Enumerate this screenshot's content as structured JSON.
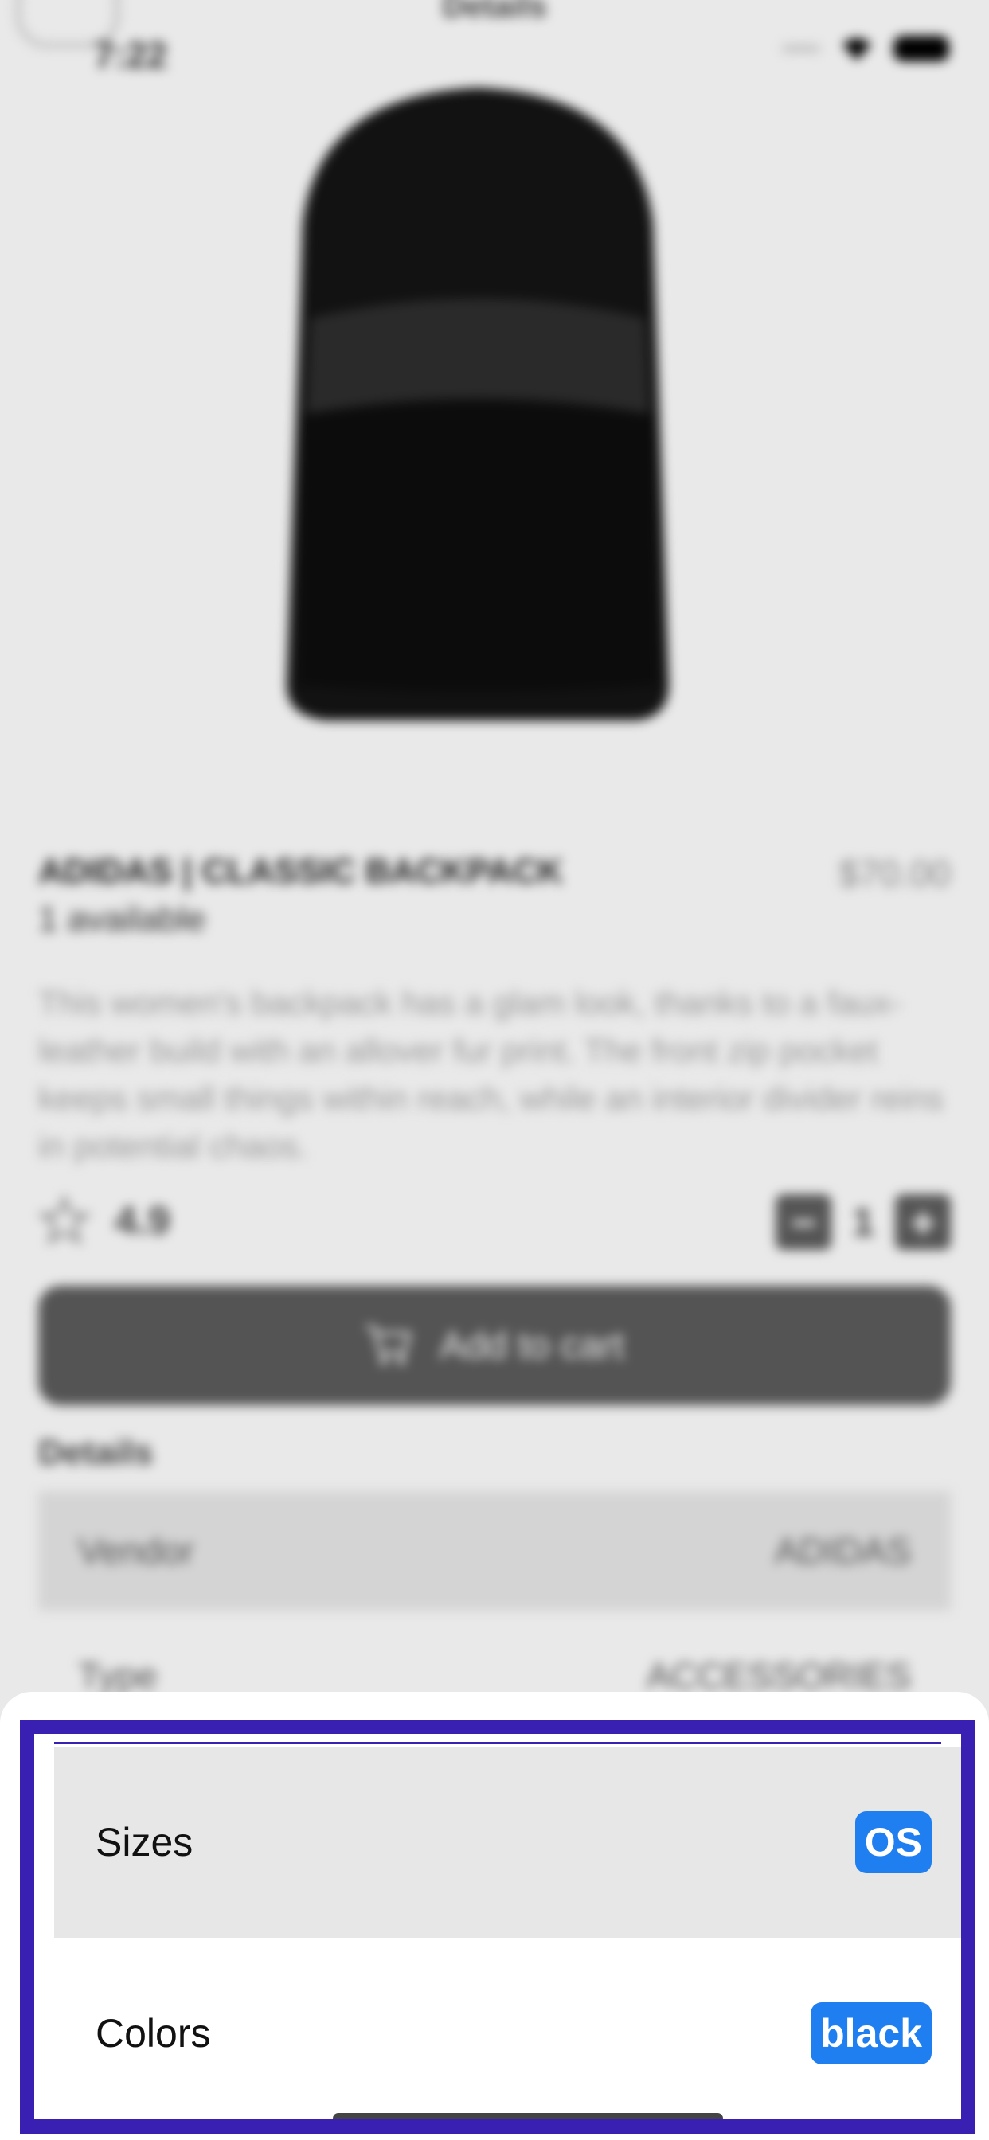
{
  "nav": {
    "title": "Details",
    "back_icon": "back-arrow-icon"
  },
  "status_bar": {
    "time": "7:22",
    "icons": [
      "signal-icon",
      "wifi-icon",
      "battery-icon"
    ]
  },
  "product": {
    "title": "ADIDAS | CLASSIC BACKPACK",
    "price": "$70.00",
    "availability": "1 available",
    "description": "This women's backpack has a glam look, thanks to a faux-leather build with an allover fur print. The front zip pocket keeps small things within reach, while an interior divider reins in potential chaos.",
    "rating": "4.9",
    "quantity": "1",
    "qty_minus": "−",
    "qty_plus": "+",
    "add_to_cart_label": "Add to cart"
  },
  "details": {
    "heading": "Details",
    "rows": [
      {
        "label": "Vendor",
        "value": "ADIDAS"
      },
      {
        "label": "Type",
        "value": "ACCESSORIES"
      }
    ]
  },
  "options": {
    "sizes_label": "Sizes",
    "sizes_value": "OS",
    "colors_label": "Colors",
    "colors_value": "black"
  },
  "colors": {
    "highlight_border": "#3a1fb3",
    "badge": "#1f7ff0",
    "cart_button": "#545454"
  }
}
